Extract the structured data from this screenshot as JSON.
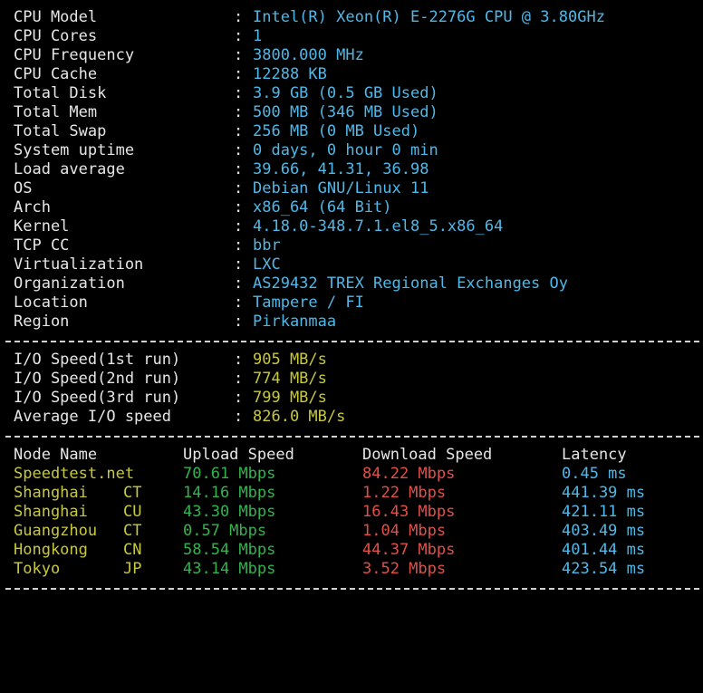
{
  "system": {
    "rows": [
      {
        "label": "CPU Model",
        "value": "Intel(R) Xeon(R) E-2276G CPU @ 3.80GHz"
      },
      {
        "label": "CPU Cores",
        "value": "1"
      },
      {
        "label": "CPU Frequency",
        "value": "3800.000 MHz"
      },
      {
        "label": "CPU Cache",
        "value": "12288 KB"
      },
      {
        "label": "Total Disk",
        "value": "3.9 GB (0.5 GB Used)"
      },
      {
        "label": "Total Mem",
        "value": "500 MB (346 MB Used)"
      },
      {
        "label": "Total Swap",
        "value": "256 MB (0 MB Used)"
      },
      {
        "label": "System uptime",
        "value": "0 days, 0 hour 0 min"
      },
      {
        "label": "Load average",
        "value": "39.66, 41.31, 36.98"
      },
      {
        "label": "OS",
        "value": "Debian GNU/Linux 11"
      },
      {
        "label": "Arch",
        "value": "x86_64 (64 Bit)"
      },
      {
        "label": "Kernel",
        "value": "4.18.0-348.7.1.el8_5.x86_64"
      },
      {
        "label": "TCP CC",
        "value": "bbr"
      },
      {
        "label": "Virtualization",
        "value": "LXC"
      },
      {
        "label": "Organization",
        "value": "AS29432 TREX Regional Exchanges Oy"
      },
      {
        "label": "Location",
        "value": "Tampere / FI"
      },
      {
        "label": "Region",
        "value": "Pirkanmaa"
      }
    ]
  },
  "separator": ":",
  "io": {
    "rows": [
      {
        "label": "I/O Speed(1st run)",
        "value": "905 MB/s"
      },
      {
        "label": "I/O Speed(2nd run)",
        "value": "774 MB/s"
      },
      {
        "label": "I/O Speed(3rd run)",
        "value": "799 MB/s"
      },
      {
        "label": "Average I/O speed",
        "value": "826.0 MB/s"
      }
    ]
  },
  "speedtest": {
    "headers": {
      "node": "Node Name",
      "upload": "Upload Speed",
      "download": "Download Speed",
      "latency": "Latency"
    },
    "rows": [
      {
        "node": "Speedtest.net",
        "cc": "",
        "upload": "70.61 Mbps",
        "download": "84.22 Mbps",
        "latency": "0.45 ms"
      },
      {
        "node": "Shanghai",
        "cc": "CT",
        "upload": "14.16 Mbps",
        "download": "1.22 Mbps",
        "latency": "441.39 ms"
      },
      {
        "node": "Shanghai",
        "cc": "CU",
        "upload": "43.30 Mbps",
        "download": "16.43 Mbps",
        "latency": "421.11 ms"
      },
      {
        "node": "Guangzhou",
        "cc": "CT",
        "upload": "0.57 Mbps",
        "download": "1.04 Mbps",
        "latency": "403.49 ms"
      },
      {
        "node": "Hongkong",
        "cc": "CN",
        "upload": "58.54 Mbps",
        "download": "44.37 Mbps",
        "latency": "401.44 ms"
      },
      {
        "node": "Tokyo",
        "cc": "JP",
        "upload": "43.14 Mbps",
        "download": "3.52 Mbps",
        "latency": "423.54 ms"
      }
    ]
  },
  "colors": {
    "background": "#000000",
    "label": "#e6e6e6",
    "system_value": "#4fb8e8",
    "io_value": "#c8c83c",
    "node_name": "#c8c83c",
    "upload": "#33b34e",
    "download": "#e0504a",
    "latency": "#4fb8e8"
  }
}
